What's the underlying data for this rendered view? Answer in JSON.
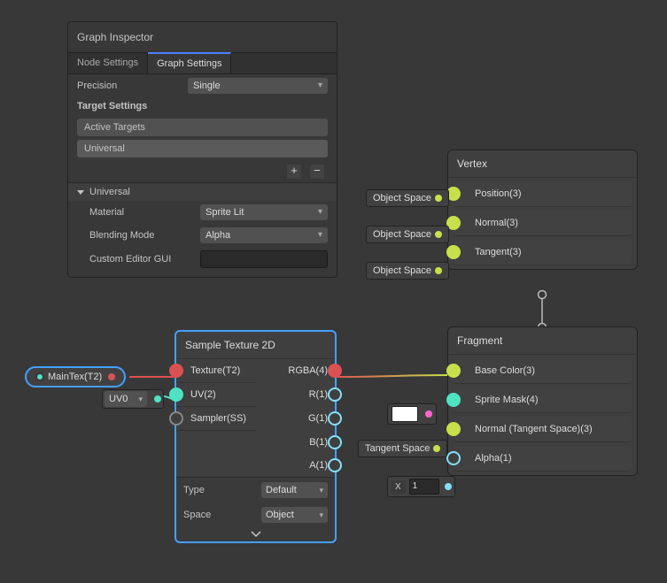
{
  "inspector": {
    "title": "Graph Inspector",
    "tabs": {
      "node": "Node Settings",
      "graph": "Graph Settings"
    },
    "precision_label": "Precision",
    "precision_value": "Single",
    "target_settings": "Target Settings",
    "active_targets": "Active Targets",
    "universal": "Universal",
    "material_label": "Material",
    "material_value": "Sprite Lit",
    "blending_label": "Blending Mode",
    "blending_value": "Alpha",
    "custom_editor": "Custom Editor GUI"
  },
  "vertex": {
    "title": "Vertex",
    "slots": [
      "Position(3)",
      "Normal(3)",
      "Tangent(3)"
    ],
    "pill": "Object Space"
  },
  "fragment": {
    "title": "Fragment",
    "slots": [
      "Base Color(3)",
      "Sprite Mask(4)",
      "Normal (Tangent Space)(3)",
      "Alpha(1)"
    ],
    "pill_objspace": "Object Space",
    "pill_tanspace": "Tangent Space"
  },
  "sample": {
    "title": "Sample Texture 2D",
    "in": [
      "Texture(T2)",
      "UV(2)",
      "Sampler(SS)"
    ],
    "out": [
      "RGBA(4)",
      "R(1)",
      "G(1)",
      "B(1)",
      "A(1)"
    ],
    "type_label": "Type",
    "type_value": "Default",
    "space_label": "Space",
    "space_value": "Object"
  },
  "maintex": "MainTex(T2)",
  "uv_select": "UV0",
  "x_label": "X",
  "x_value": "1"
}
